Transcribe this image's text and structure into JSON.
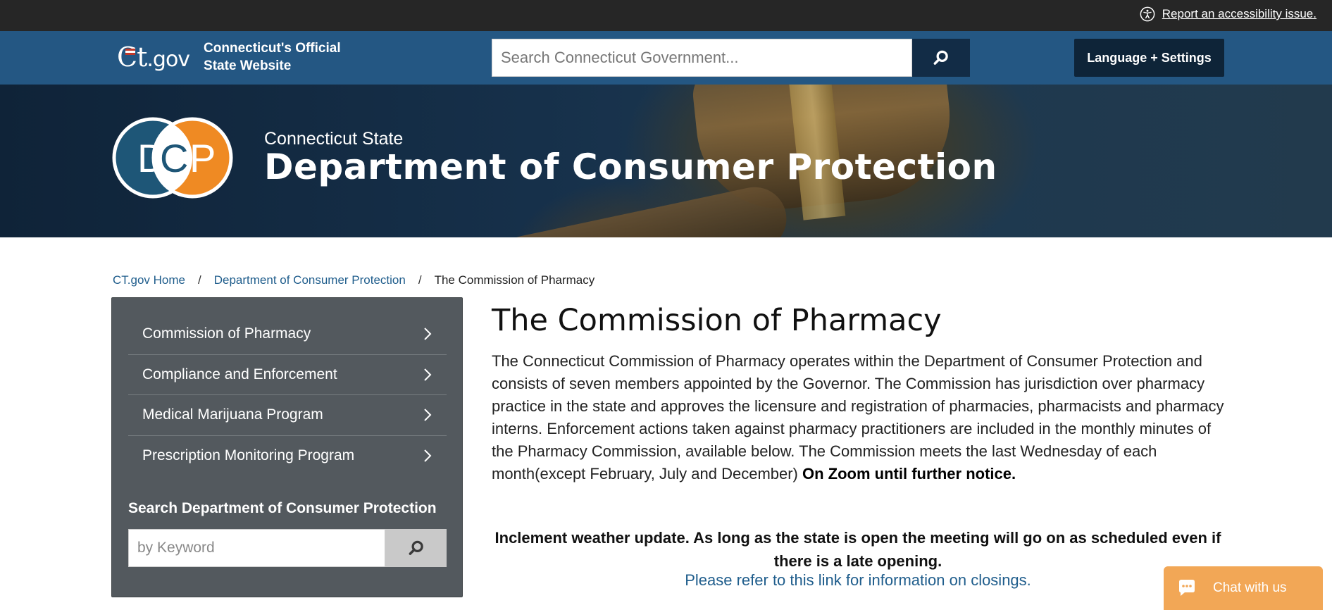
{
  "utility": {
    "accessibility_link": "Report an accessibility issue."
  },
  "header": {
    "logo_mark_ct": "Ct",
    "logo_mark_gov": ".gov",
    "logo_text_line1": "Connecticut's Official",
    "logo_text_line2": "State Website",
    "search_placeholder": "Search Connecticut Government...",
    "language_button": "Language + Settings"
  },
  "hero": {
    "logo_letters": [
      "D",
      "C",
      "P"
    ],
    "kicker": "Connecticut State",
    "title": "Department of Consumer Protection"
  },
  "breadcrumb": {
    "home": "CT.gov Home",
    "separator": "/",
    "department": "Department of Consumer Protection",
    "current": "The Commission of Pharmacy"
  },
  "sidebar": {
    "items": [
      {
        "label": "Commission of Pharmacy"
      },
      {
        "label": "Compliance and Enforcement"
      },
      {
        "label": "Medical Marijuana Program"
      },
      {
        "label": "Prescription Monitoring Program"
      }
    ],
    "search_title": "Search Department of Consumer Protection",
    "search_placeholder": "by Keyword"
  },
  "main": {
    "title": "The Commission of Pharmacy",
    "intro": "The Connecticut Commission of Pharmacy operates within the Department of Consumer Protection and consists of seven members appointed by the Governor. The Commission has jurisdiction over pharmacy practice in the state and approves the licensure and registration of pharmacies, pharmacists and pharmacy interns. Enforcement actions taken against pharmacy practitioners are included in the monthly minutes of the Pharmacy Commission, available below. The Commission meets the last Wednesday of each month(except February, July and December)",
    "intro_bold": "On Zoom until further notice.",
    "notice": "Inclement weather update. As long as the state is open the meeting will go on as scheduled even if there is a late opening.",
    "closings_link": "Please refer to this link for information on closings."
  },
  "chat": {
    "label": "Chat with us"
  },
  "colors": {
    "utility_bar": "#262626",
    "header_bar": "#245783",
    "sidebar": "#53595e",
    "link": "#1f5d8c",
    "dcp_blue": "#1e5677",
    "dcp_orange": "#ef8a23",
    "chat": "#f2a756"
  },
  "icons": {
    "accessibility": "accessibility-icon",
    "search": "search-icon",
    "chevron": "chevron-right-icon",
    "chat": "chat-bubble-icon"
  }
}
